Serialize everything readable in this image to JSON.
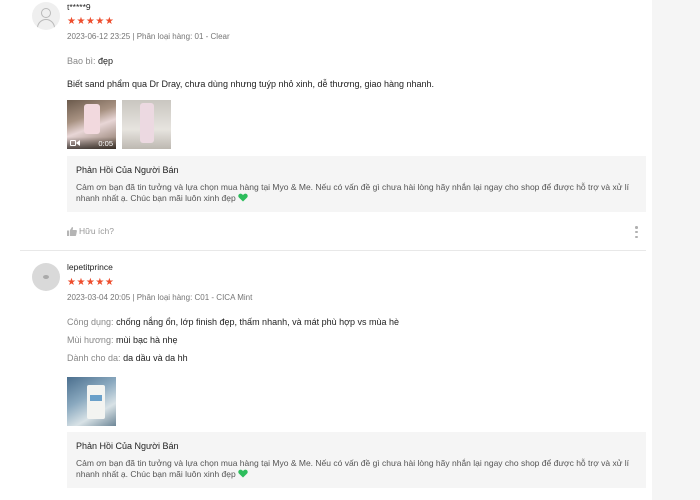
{
  "reviews": [
    {
      "username": "t*****9",
      "stars": "★★★★★",
      "meta": "2023-06-12 23:25 | Phân loại hàng: 01 - Clear",
      "attributes": [
        {
          "key": "Bao bì:",
          "value": "đẹp"
        }
      ],
      "body": "Biết sand phẩm qua Dr Dray, chưa dùng nhưng tuýp nhỏ xinh, dễ thương, giao hàng nhanh.",
      "media": [
        {
          "type": "video",
          "duration": "0:05"
        },
        {
          "type": "image"
        }
      ],
      "seller_reply": {
        "title": "Phản Hồi Của Người Bán",
        "text": "Cảm ơn bạn đã tin tưởng và lựa chọn mua hàng tại Myo & Me. Nếu có vấn đề gì chưa hài lòng hãy nhắn lại ngay cho shop để được hỗ trợ và xử lí nhanh nhất ạ. Chúc bạn mãi luôn xinh đẹp"
      },
      "helpful_label": "Hữu ích?"
    },
    {
      "username": "lepetitprince",
      "stars": "★★★★★",
      "meta": "2023-03-04 20:05 | Phân loại hàng: C01 - CICA Mint",
      "attributes": [
        {
          "key": "Công dụng:",
          "value": "chống nắng ổn, lớp finish đẹp, thấm nhanh, và mát phù hợp vs mùa hè"
        },
        {
          "key": "Mùi hương:",
          "value": "mùi bạc hà nhẹ"
        },
        {
          "key": "Dành cho da:",
          "value": "da dầu và da hh"
        }
      ],
      "media": [
        {
          "type": "image"
        }
      ],
      "seller_reply": {
        "title": "Phản Hồi Của Người Bán",
        "text": "Cảm ơn bạn đã tin tưởng và lựa chọn mua hàng tại Myo & Me. Nếu có vấn đề gì chưa hài lòng hãy nhắn lại ngay cho shop để được hỗ trợ và xử lí nhanh nhất ạ. Chúc bạn mãi luôn xinh đẹp"
      }
    }
  ],
  "icons": {
    "star_color": "#ee4d2d",
    "heart_color": "#2dbd5c"
  }
}
